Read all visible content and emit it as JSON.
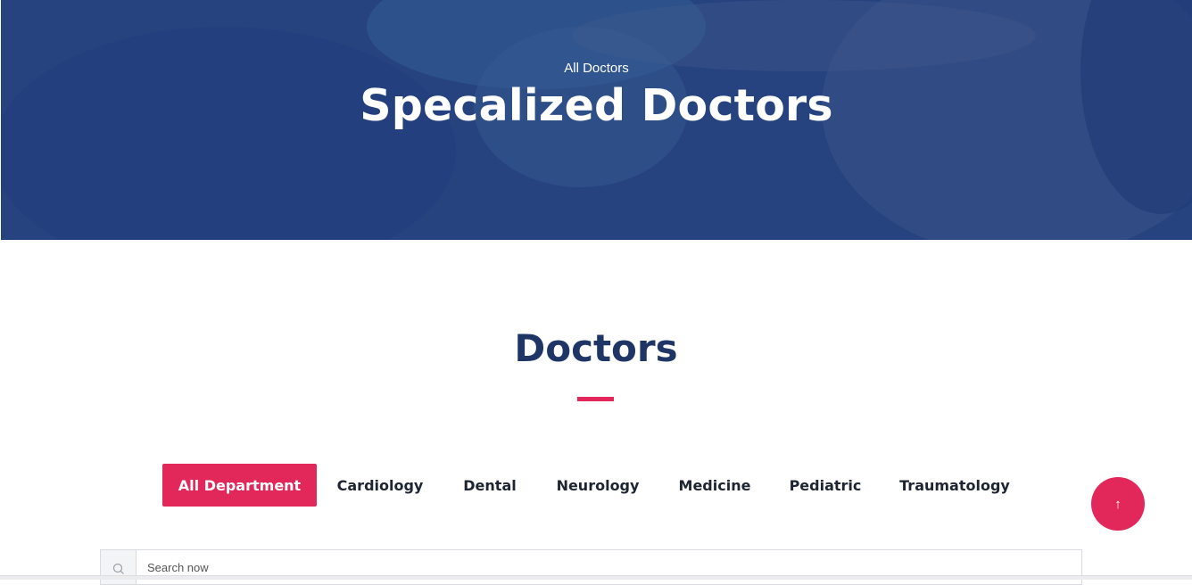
{
  "hero": {
    "subtitle": "All Doctors",
    "title": "Specalized Doctors"
  },
  "section": {
    "title": "Doctors"
  },
  "tabs": [
    {
      "label": "All Department",
      "active": true
    },
    {
      "label": "Cardiology",
      "active": false
    },
    {
      "label": "Dental",
      "active": false
    },
    {
      "label": "Neurology",
      "active": false
    },
    {
      "label": "Medicine",
      "active": false
    },
    {
      "label": "Pediatric",
      "active": false
    },
    {
      "label": "Traumatology",
      "active": false
    }
  ],
  "search": {
    "placeholder": "Search now",
    "icon": "search-icon"
  },
  "back_to_top": {
    "icon": "arrow-up-icon",
    "glyph": "↑"
  },
  "colors": {
    "accent": "#e2275a",
    "heading": "#1f3566",
    "hero_overlay": "#2f4a85"
  }
}
